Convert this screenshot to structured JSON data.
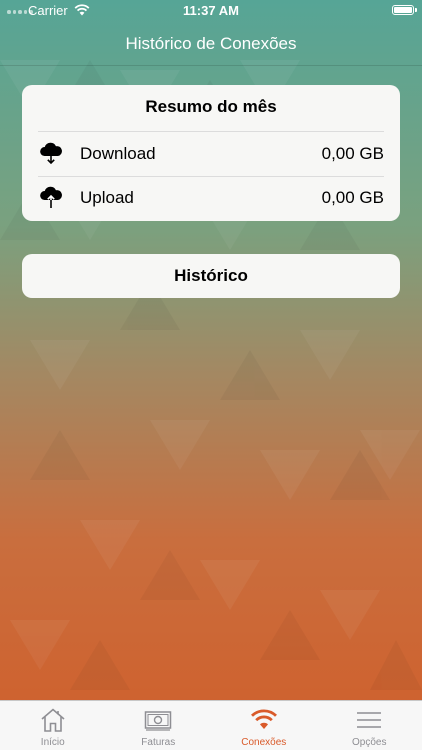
{
  "status_bar": {
    "carrier": "Carrier",
    "time": "11:37 AM"
  },
  "nav": {
    "title": "Histórico de Conexões"
  },
  "summary": {
    "title": "Resumo do mês",
    "rows": [
      {
        "label": "Download",
        "value": "0,00 GB",
        "icon": "cloud-download-icon"
      },
      {
        "label": "Upload",
        "value": "0,00 GB",
        "icon": "cloud-upload-icon"
      }
    ]
  },
  "history_button": {
    "label": "Histórico"
  },
  "tabs": [
    {
      "label": "Início",
      "icon": "home-icon",
      "active": false
    },
    {
      "label": "Faturas",
      "icon": "banknote-icon",
      "active": false
    },
    {
      "label": "Conexões",
      "icon": "wifi-icon",
      "active": true
    },
    {
      "label": "Opções",
      "icon": "menu-icon",
      "active": false
    }
  ],
  "colors": {
    "accent": "#d95a2a",
    "inactive": "#8e8e93",
    "card": "#f7f7f5"
  }
}
